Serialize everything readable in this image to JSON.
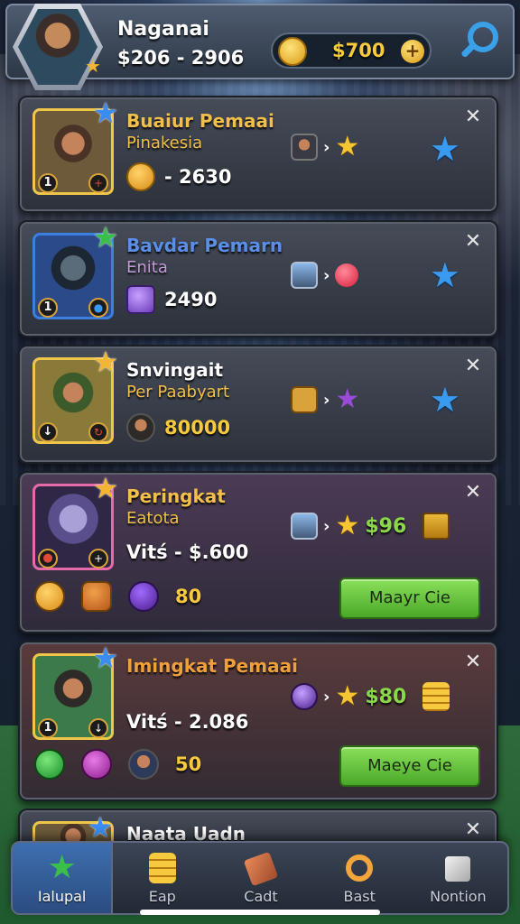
{
  "header": {
    "player_name": "Naganai",
    "player_stats": "$206 - 2906",
    "coins": "$700",
    "coin_plus": "+"
  },
  "cards": [
    {
      "title": "Buaiur Pemaai",
      "subtitle": "Pinakesia",
      "value": "- 2630",
      "level": "1",
      "position": "+"
    },
    {
      "title": "Bavdar Pemarn",
      "subtitle": "Enita",
      "value": "2490",
      "level": "1"
    },
    {
      "title": "Snvingait",
      "subtitle": "Per Paabyart",
      "value": "80000"
    },
    {
      "title": "Peringkat",
      "subtitle": "Eatota",
      "value": "Vitś - $.600",
      "price": "$96",
      "bottom_value": "80",
      "button_label": "Maayr Cie"
    },
    {
      "title": "Imingkat Pemaai",
      "value": "Vitś - 2.086",
      "level": "1",
      "price": "$80",
      "bottom_value": "50",
      "button_label": "Maeye Cie"
    },
    {
      "title": "Naata Uadn"
    }
  ],
  "close_symbol": "✕",
  "arrow_symbol": "›",
  "nav": [
    {
      "label": "Ialupal",
      "icon": "star-icon",
      "active": true
    },
    {
      "label": "Eap",
      "icon": "coins-icon",
      "active": false
    },
    {
      "label": "Cadt",
      "icon": "card-icon",
      "active": false
    },
    {
      "label": "Bast",
      "icon": "ring-icon",
      "active": false
    },
    {
      "label": "Nontion",
      "icon": "box-icon",
      "active": false
    }
  ],
  "colors": {
    "accent_gold": "#f6c93f",
    "accent_green": "#8ad84a",
    "accent_blue": "#3a9af0"
  }
}
